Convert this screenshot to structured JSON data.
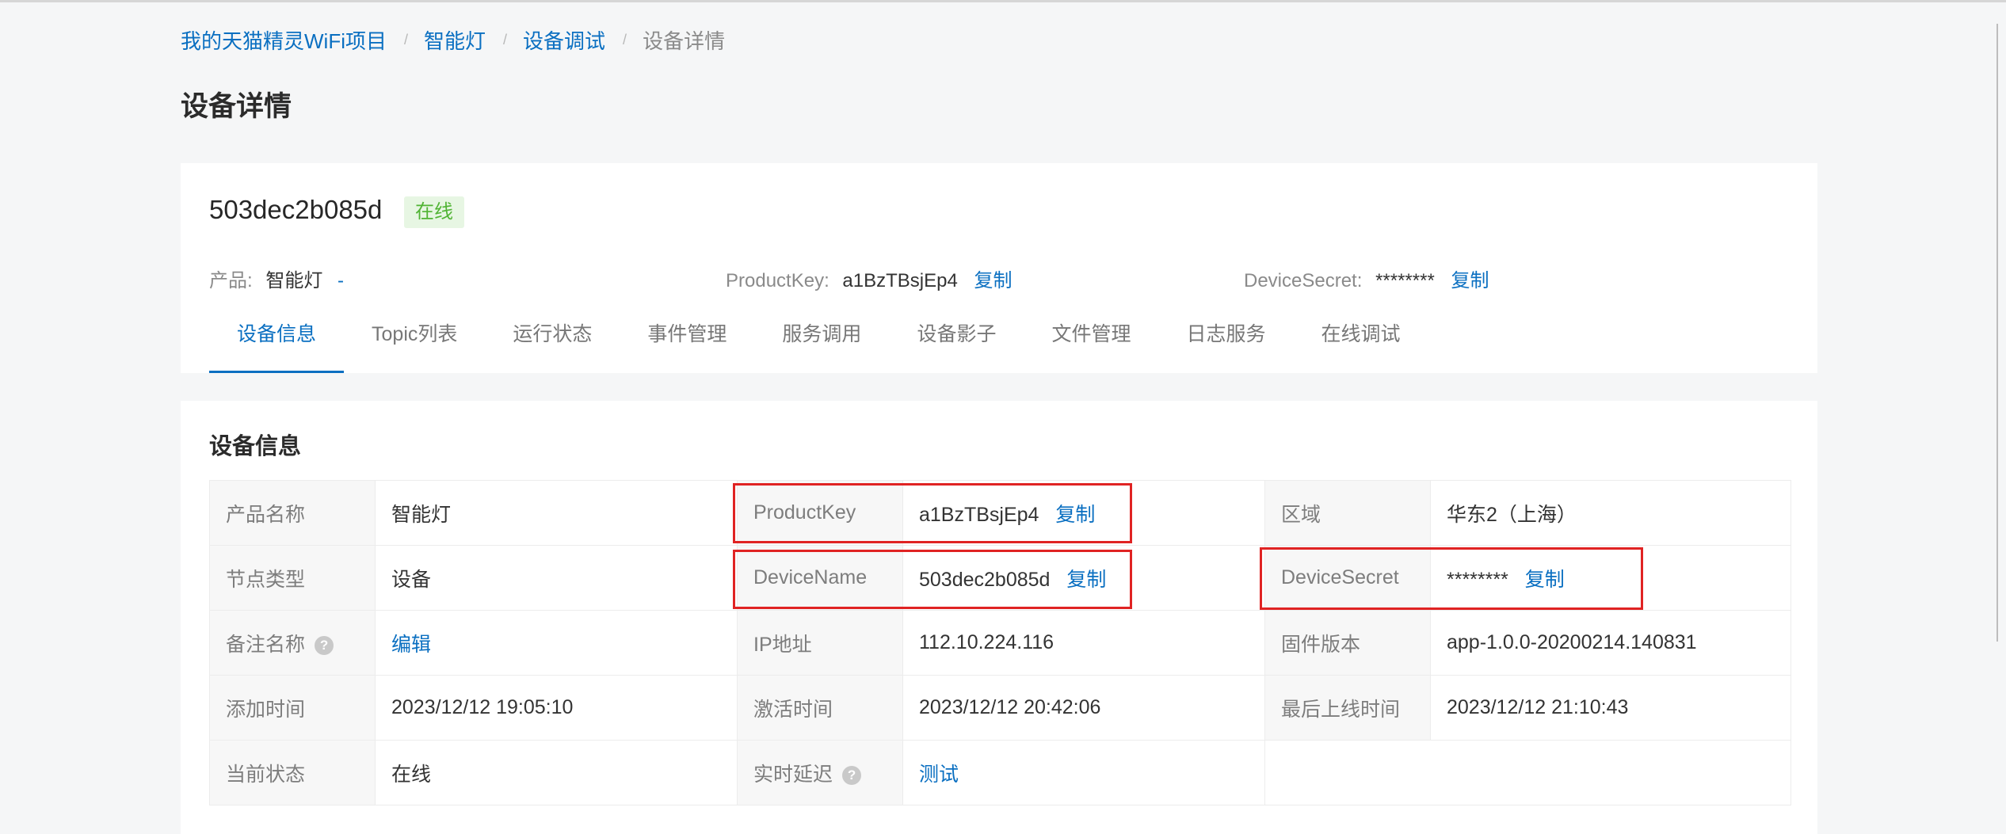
{
  "breadcrumb": {
    "items": [
      "我的天猫精灵WiFi项目",
      "智能灯",
      "设备调试"
    ],
    "current": "设备详情",
    "separator": "/"
  },
  "page_title": "设备详情",
  "header": {
    "device_name": "503dec2b085d",
    "status_badge": "在线",
    "product_label": "产品:",
    "product_value": "智能灯",
    "product_link": "-",
    "productkey_label": "ProductKey:",
    "productkey_value": "a1BzTBsjEp4",
    "productkey_copy": "复制",
    "devicesecret_label": "DeviceSecret:",
    "devicesecret_value": "********",
    "devicesecret_copy": "复制"
  },
  "tabs": [
    "设备信息",
    "Topic列表",
    "运行状态",
    "事件管理",
    "服务调用",
    "设备影子",
    "文件管理",
    "日志服务",
    "在线调试"
  ],
  "info": {
    "title": "设备信息",
    "rows": [
      [
        {
          "label": "产品名称",
          "value": "智能灯"
        },
        {
          "label": "ProductKey",
          "value": "a1BzTBsjEp4",
          "action": "复制"
        },
        {
          "label": "区域",
          "value": "华东2（上海）"
        }
      ],
      [
        {
          "label": "节点类型",
          "value": "设备"
        },
        {
          "label": "DeviceName",
          "value": "503dec2b085d",
          "action": "复制"
        },
        {
          "label": "DeviceSecret",
          "value": "********",
          "action": "复制"
        }
      ],
      [
        {
          "label": "备注名称",
          "help": "?",
          "action": "编辑"
        },
        {
          "label": "IP地址",
          "value": "112.10.224.116"
        },
        {
          "label": "固件版本",
          "value": "app-1.0.0-20200214.140831"
        }
      ],
      [
        {
          "label": "添加时间",
          "value": "2023/12/12 19:05:10"
        },
        {
          "label": "激活时间",
          "value": "2023/12/12 20:42:06"
        },
        {
          "label": "最后上线时间",
          "value": "2023/12/12 21:10:43"
        }
      ],
      [
        {
          "label": "当前状态",
          "value": "在线"
        },
        {
          "label": "实时延迟",
          "help": "?",
          "action": "测试"
        }
      ]
    ]
  },
  "colors": {
    "link": "#0a6fc1",
    "online_text": "#51b435",
    "online_bg": "#e7f6e3",
    "highlight_box": "#e02323"
  }
}
